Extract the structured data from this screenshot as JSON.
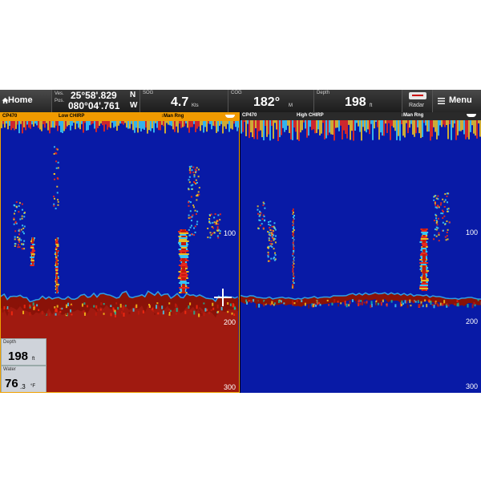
{
  "topbar": {
    "home_label": "Home",
    "home_icon": "home-icon",
    "vessel_label_1": "Ves.",
    "vessel_label_2": "Pos.",
    "lat": "25°58'.829",
    "lat_hemi": "N",
    "lon": "080°04'.761",
    "lon_hemi": "W",
    "sog_label": "SOG",
    "sog_value": "4.7",
    "sog_unit": "Kts",
    "cog_label": "COG",
    "cog_value": "182°",
    "cog_unit": "M",
    "depth_label": "Depth",
    "depth_value": "198",
    "depth_unit": "ft",
    "radar_label": "Radar",
    "menu_label": "Menu",
    "menu_icon": "menu-lines-icon"
  },
  "left_pane": {
    "device": "CP470",
    "mode": "Low CHIRP",
    "range_mode": "↕Man Rng",
    "scale_100": "100",
    "scale_200": "200",
    "scale_300": "300",
    "depth_box_label": "Depth",
    "depth_box_value": "198",
    "depth_box_unit": "ft",
    "water_box_label": "Water",
    "water_box_value": "76",
    "water_box_decimal": ".3",
    "water_box_unit": "°F"
  },
  "right_pane": {
    "device": "CP470",
    "mode": "High CHIRP",
    "range_mode": "↕Man Rng",
    "scale_100": "100",
    "scale_200": "200",
    "scale_300": "300"
  },
  "colors": {
    "water": "#081aa6",
    "accent": "#f09a00",
    "bottom_red": "#8a1208"
  }
}
